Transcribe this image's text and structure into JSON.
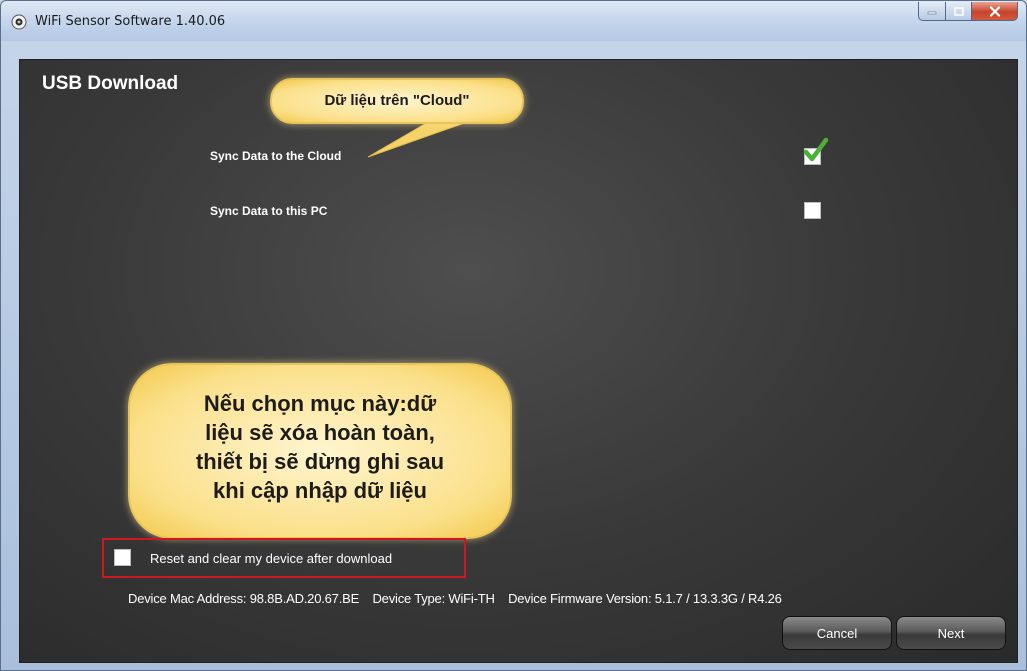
{
  "window": {
    "title": "WiFi Sensor Software 1.40.06",
    "icon": "app-eye-icon"
  },
  "page": {
    "title": "USB Download"
  },
  "options": {
    "sync_cloud": {
      "label": "Sync Data to the Cloud",
      "checked": true
    },
    "sync_pc": {
      "label": "Sync Data to this PC",
      "checked": false
    },
    "reset": {
      "label": "Reset and clear my device after download",
      "checked": false
    }
  },
  "callouts": {
    "cloud": "Dữ liệu trên \"Cloud\"",
    "reset_lines": [
      "Nếu chọn mục này:dữ",
      "liệu sẽ xóa hoàn toàn,",
      "thiết bị sẽ dừng ghi sau",
      "khi cập nhập dữ liệu"
    ]
  },
  "device_info": {
    "mac": "Device Mac Address: 98.8B.AD.20.67.BE",
    "type": "Device Type: WiFi-TH",
    "firmware": "Device Firmware Version: 5.1.7 / 13.3.3G / R4.26"
  },
  "buttons": {
    "cancel": "Cancel",
    "next": "Next"
  },
  "colors": {
    "highlight_border": "#d0161e",
    "check_green": "#4caf3a",
    "callout_fill": "#fbe08a"
  }
}
